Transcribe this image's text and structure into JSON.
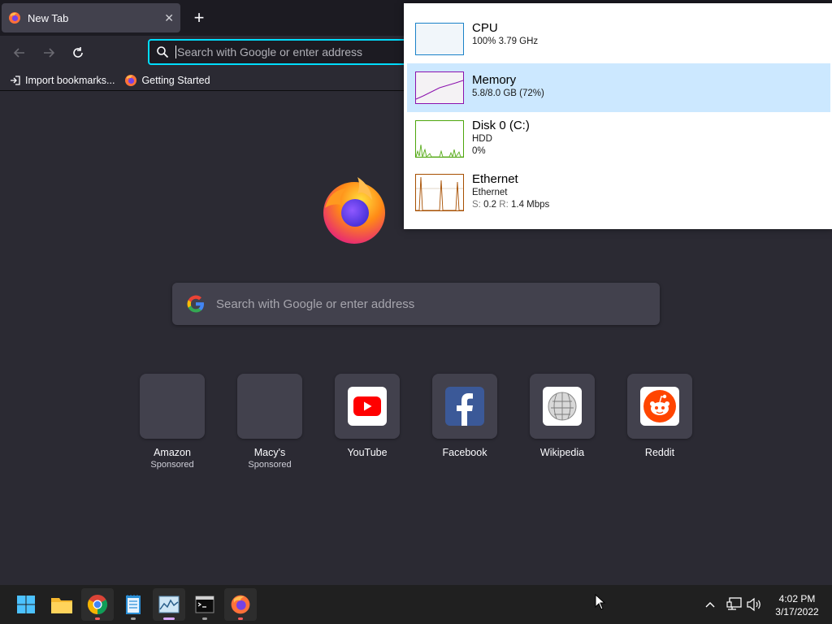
{
  "browser": {
    "tab_title": "New Tab",
    "tab_close": "✕",
    "new_tab": "+",
    "urlbar_placeholder": "Search with Google or enter address",
    "bookmarks": [
      {
        "label": "Import bookmarks..."
      },
      {
        "label": "Getting Started"
      }
    ]
  },
  "newtab": {
    "search_placeholder": "Search with Google or enter address",
    "top_sites": [
      {
        "label": "Amazon",
        "sub": "Sponsored",
        "icon": "blank"
      },
      {
        "label": "Macy's",
        "sub": "Sponsored",
        "icon": "blank"
      },
      {
        "label": "YouTube",
        "sub": "",
        "icon": "youtube-icon"
      },
      {
        "label": "Facebook",
        "sub": "",
        "icon": "facebook-icon"
      },
      {
        "label": "Wikipedia",
        "sub": "",
        "icon": "wikipedia-icon"
      },
      {
        "label": "Reddit",
        "sub": "",
        "icon": "reddit-icon"
      }
    ]
  },
  "performance": {
    "items": [
      {
        "name": "CPU",
        "line1": "100%  3.79 GHz",
        "line2": "",
        "color": "#1a82c8",
        "utilization": 1.0
      },
      {
        "name": "Memory",
        "line1": "5.8/8.0 GB (72%)",
        "line2": "",
        "color": "#8b12ae",
        "utilization": 0.72
      },
      {
        "name": "Disk 0 (C:)",
        "line1": "HDD",
        "line2": "0%",
        "color": "#4da60c",
        "utilization": 0.0
      },
      {
        "name": "Ethernet",
        "line1": "Ethernet",
        "line2_s_label": "S:",
        "line2_s": "0.2",
        "line2_r_label": "R:",
        "line2_r": "1.4 Mbps",
        "color": "#a74f01"
      }
    ]
  },
  "taskbar": {
    "time": "4:02 PM",
    "date": "3/17/2022"
  },
  "colors": {
    "accent": "#00ddff",
    "selection": "#cce8ff"
  }
}
